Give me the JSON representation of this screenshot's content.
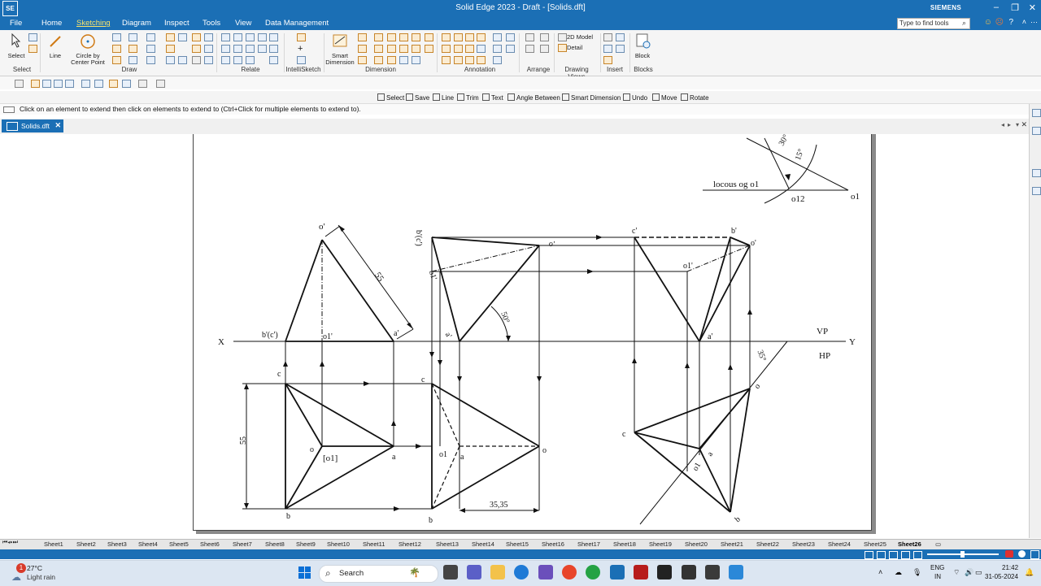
{
  "app": {
    "window_title": "Solid Edge 2023 - Draft - [Solids.dft]",
    "logo": "SE",
    "brand": "SIEMENS"
  },
  "menu": {
    "items": [
      "File",
      "Home",
      "Sketching",
      "Diagram",
      "Inspect",
      "Tools",
      "View",
      "Data Management"
    ],
    "active": "Sketching",
    "find_placeholder": "Type to find tools"
  },
  "ribbon": {
    "select_label": "Select",
    "line_label": "Line",
    "circle_label": "Circle by Center Point",
    "smart_dimension_label": "Smart Dimension",
    "model_2d_label": "2D Model",
    "detail_label": "Detail",
    "block_label": "Block",
    "groups": [
      "Select",
      "Draw",
      "Relate",
      "IntelliSketch",
      "Dimension",
      "Annotation",
      "Arrange",
      "Drawing Views",
      "Insert",
      "Blocks"
    ]
  },
  "command_bar": {
    "items": [
      "Select",
      "Save",
      "Line",
      "Trim",
      "Text",
      "Angle Between",
      "Smart Dimension",
      "Undo",
      "Move",
      "Rotate"
    ],
    "prompt": "Click on an element to extend then click on elements to extend to (Ctrl+Click for multiple elements to extend to)."
  },
  "document": {
    "tab": "Solids.dft"
  },
  "drawing": {
    "x_label": "X",
    "y_label": "Y",
    "vp": "VP",
    "hp": "HP",
    "locus": "locous og o1",
    "o12": "o12",
    "o1_top": "o1",
    "o_prime": "o'",
    "dim_55_slant": "55",
    "bc_prime": "b'(c')",
    "o1_prime": "o1'",
    "a_prime": "a'",
    "c": "c",
    "b": "b",
    "a": "a",
    "o": "o",
    "o1_bracket": "[o1]",
    "dim_55_vert": "55",
    "bc2": "b'(c')",
    "o_p2": "o'",
    "o1p2": "o1'",
    "ap2": "a'",
    "angle50": "50°",
    "c2": "c",
    "o12b": "o1",
    "a2": "a",
    "o2": "o",
    "b2": "b",
    "dim3535": "35,35",
    "cp3": "c'",
    "bp3": "b'",
    "op3": "o'",
    "o1p3": "o1'",
    "ap3": "a'",
    "angle35": "35°",
    "c3": "c",
    "o3": "o",
    "o13": "o1",
    "a3": "a",
    "b3": "b",
    "angle30": "30°",
    "angle15": "15°"
  },
  "sheet_tabs": {
    "items": [
      "Sheet1",
      "Sheet2",
      "Sheet3",
      "Sheet4",
      "Sheet5",
      "Sheet6",
      "Sheet7",
      "Sheet8",
      "Sheet9",
      "Sheet10",
      "Sheet11",
      "Sheet12",
      "Sheet13",
      "Sheet14",
      "Sheet15",
      "Sheet16",
      "Sheet17",
      "Sheet18",
      "Sheet19",
      "Sheet20",
      "Sheet21",
      "Sheet22",
      "Sheet23",
      "Sheet24",
      "Sheet25",
      "Sheet26"
    ],
    "active": "Sheet26"
  },
  "taskbar": {
    "weather_temp": "27°C",
    "weather_desc": "Light rain",
    "search": "Search",
    "lang1": "ENG",
    "lang2": "IN",
    "time": "21:42",
    "date": "31-05-2024",
    "weather_badge": "1"
  },
  "colors": {
    "titlebar": "#1b6fb5",
    "active_menu": "#f8e36b"
  }
}
